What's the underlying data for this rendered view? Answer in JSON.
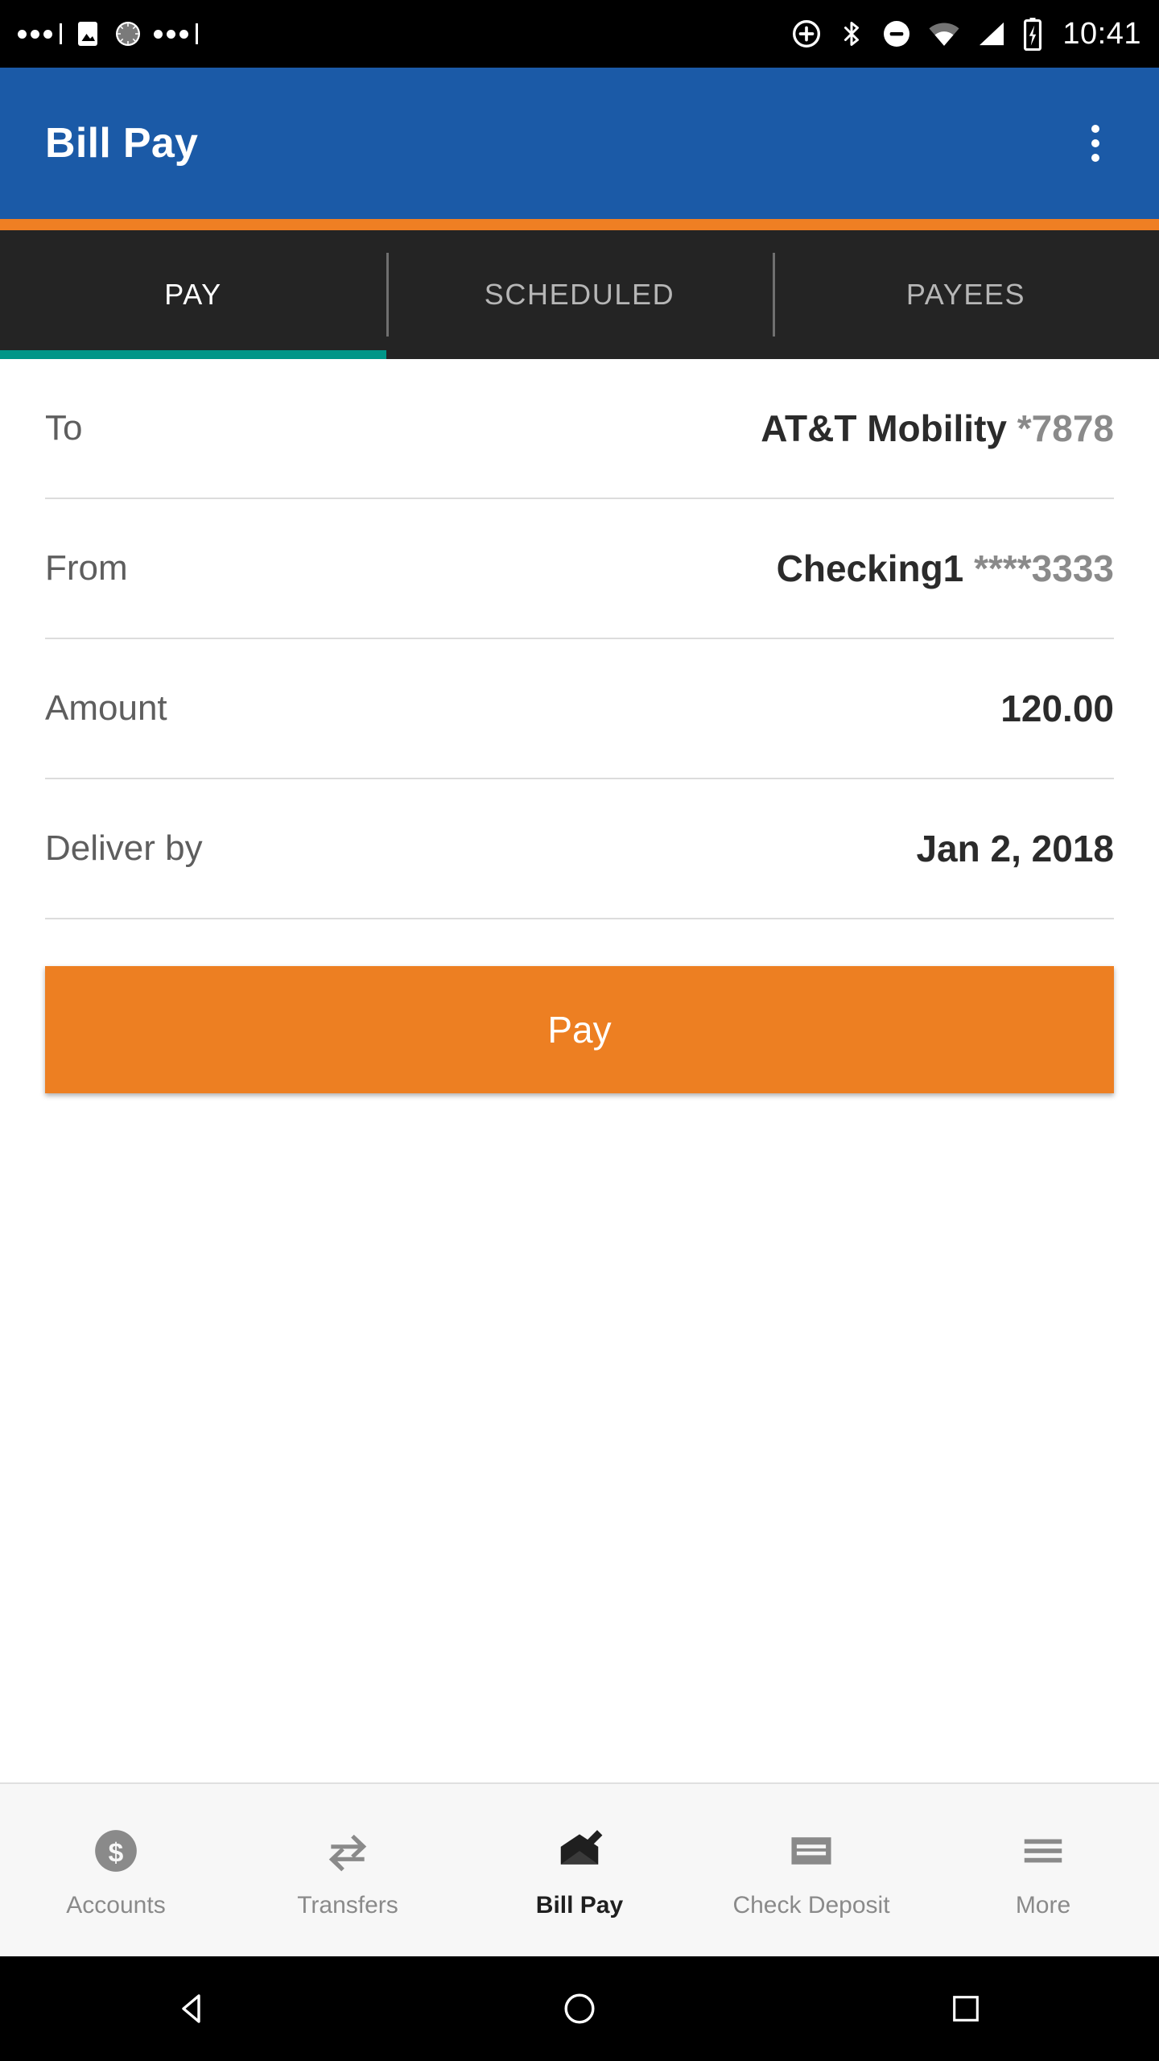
{
  "status_bar": {
    "time": "10:41",
    "left_icons": [
      "dots-icon",
      "image-icon",
      "sync-spinner-icon",
      "dots-icon"
    ],
    "right_icons": [
      "add-circle-icon",
      "bluetooth-icon",
      "do-not-disturb-icon",
      "wifi-icon",
      "cell-signal-icon",
      "battery-charging-icon"
    ]
  },
  "app_bar": {
    "title": "Bill Pay",
    "overflow_icon": "more-vert-icon",
    "background": "#1b5aa7",
    "accent_rule": "#ef7f23"
  },
  "tabs": {
    "indicator_color": "#009688",
    "active_index": 0,
    "items": [
      {
        "label": "PAY"
      },
      {
        "label": "SCHEDULED"
      },
      {
        "label": "PAYEES"
      }
    ]
  },
  "form": {
    "rows": [
      {
        "label": "To",
        "value": "AT&T Mobility",
        "value_suffix": "*7878"
      },
      {
        "label": "From",
        "value": "Checking1",
        "value_suffix": "****3333"
      },
      {
        "label": "Amount",
        "value": "120.00",
        "value_suffix": ""
      },
      {
        "label": "Deliver by",
        "value": "Jan 2, 2018",
        "value_suffix": ""
      }
    ],
    "submit_label": "Pay",
    "submit_color": "#ed7f22"
  },
  "bottom_nav": {
    "active_index": 2,
    "items": [
      {
        "label": "Accounts",
        "icon": "dollar-circle-icon"
      },
      {
        "label": "Transfers",
        "icon": "transfer-arrows-icon"
      },
      {
        "label": "Bill Pay",
        "icon": "envelope-pen-icon"
      },
      {
        "label": "Check Deposit",
        "icon": "check-lines-icon"
      },
      {
        "label": "More",
        "icon": "hamburger-icon"
      }
    ]
  },
  "system_nav": {
    "back": "back-triangle-icon",
    "home": "home-circle-icon",
    "recents": "recents-square-icon"
  }
}
